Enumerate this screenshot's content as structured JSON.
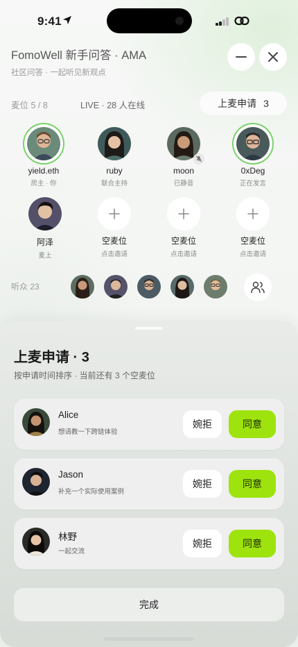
{
  "status_bar": {
    "time": "9:41"
  },
  "header": {
    "title": "FomoWell 新手问答 · AMA",
    "subtitle": "社区问答 · 一起听见新观点"
  },
  "mic_section": {
    "label": "麦位 5 / 8",
    "live": "LIVE · 28 人在线",
    "request_label": "上麦申请",
    "request_count": "3"
  },
  "seats": [
    {
      "name": "yield.eth",
      "role": "房主 · 你",
      "speaking": true
    },
    {
      "name": "ruby",
      "role": "联合主持",
      "speaking": false
    },
    {
      "name": "moon",
      "role": "已静音",
      "muted": true
    },
    {
      "name": "0xDeg",
      "role": "正在发言",
      "speaking": true
    },
    {
      "name": "阿泽",
      "role": "麦上"
    },
    {
      "name": "空麦位",
      "role": "点击邀请"
    },
    {
      "name": "空麦位",
      "role": "点击邀请"
    },
    {
      "name": "空麦位",
      "role": "点击邀请"
    }
  ],
  "audience": {
    "label": "听众 23"
  },
  "sheet": {
    "title": "上麦申请 · 3",
    "subtitle": "按申请时间排序 · 当前还有 3 个空麦位",
    "requests": [
      {
        "name": "Alice",
        "message": "想请教一下跨链体验",
        "reject": "婉拒",
        "accept": "同意"
      },
      {
        "name": "Jason",
        "message": "补充一个实际使用案例",
        "reject": "婉拒",
        "accept": "同意"
      },
      {
        "name": "林野",
        "message": "一起交流",
        "reject": "婉拒",
        "accept": "同意"
      }
    ],
    "done": "完成"
  },
  "colors": {
    "accent": "#9ee30e",
    "speaking_ring": "#7ad16a"
  }
}
